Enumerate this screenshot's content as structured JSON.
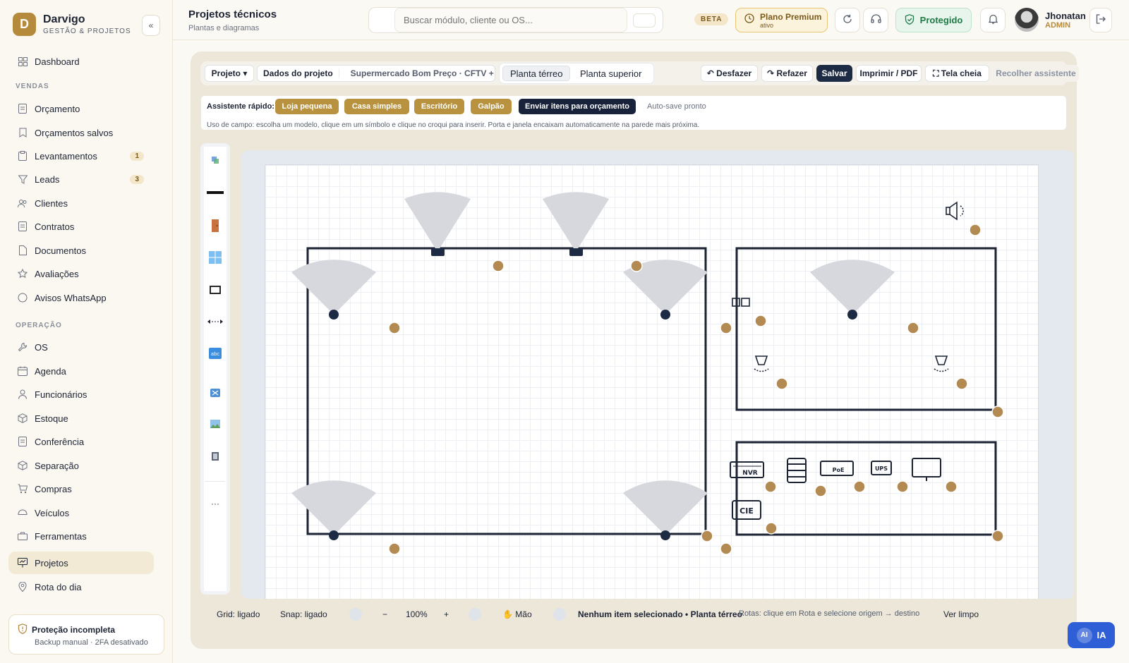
{
  "brand": {
    "initial": "D",
    "name": "Darvigo",
    "subtitle": "GESTÃO & PROJETOS",
    "collapse": "«"
  },
  "sidebar": {
    "items": [
      {
        "label": "Dashboard",
        "icon": "grid-icon"
      },
      {
        "section": "VENDAS"
      },
      {
        "label": "Orçamento",
        "icon": "document-icon"
      },
      {
        "label": "Orçamentos salvos",
        "icon": "bookmark-icon"
      },
      {
        "label": "Levantamentos",
        "icon": "clipboard-icon",
        "badge": "1"
      },
      {
        "label": "Leads",
        "icon": "filter-icon",
        "badge": "3"
      },
      {
        "label": "Clientes",
        "icon": "users-icon"
      },
      {
        "label": "Contratos",
        "icon": "document-icon"
      },
      {
        "label": "Documentos",
        "icon": "file-icon"
      },
      {
        "label": "Avaliações",
        "icon": "star-icon"
      },
      {
        "label": "Avisos WhatsApp",
        "icon": "chat-icon"
      },
      {
        "section": "OPERAÇÃO"
      },
      {
        "label": "OS",
        "icon": "wrench-icon"
      },
      {
        "label": "Agenda",
        "icon": "calendar-icon"
      },
      {
        "label": "Funcionários",
        "icon": "user-icon"
      },
      {
        "label": "Estoque",
        "icon": "box-icon"
      },
      {
        "label": "Conferência",
        "icon": "checklist-icon"
      },
      {
        "label": "Separação",
        "icon": "package-icon"
      },
      {
        "label": "Compras",
        "icon": "cart-icon"
      },
      {
        "label": "Veículos",
        "icon": "truck-icon"
      },
      {
        "label": "Ferramentas",
        "icon": "toolbox-icon"
      },
      {
        "label": "Projetos",
        "icon": "presentation-icon",
        "active": true
      },
      {
        "label": "Rota do dia",
        "icon": "pin-icon"
      }
    ],
    "protection": {
      "title": "Proteção incompleta",
      "subtitle": "Backup manual · 2FA desativado"
    }
  },
  "header": {
    "title": "Projetos técnicos",
    "subtitle": "Plantas e diagramas",
    "search_placeholder": "Buscar módulo, cliente ou OS...",
    "beta": "BETA",
    "plan_title": "Plano Premium",
    "plan_status": "ativo",
    "protected": "Protegido",
    "user_name": "Jhonatan",
    "user_role": "ADMIN"
  },
  "toolbar": {
    "project_menu": "Projeto ▾",
    "project_data": "Dados do projeto",
    "project_name": "Supermercado Bom Preço · CFTV + Alarme",
    "tabs": [
      "Planta térreo",
      "Planta superior"
    ],
    "undo": "↶ Desfazer",
    "redo": "↷ Refazer",
    "save": "Salvar",
    "print": "Imprimir / PDF",
    "fullscreen": "⛶ Tela cheia",
    "collapse_assistant": "Recolher assistente"
  },
  "assistant": {
    "label": "Assistente rápido:",
    "presets": [
      "Loja pequena",
      "Casa simples",
      "Escritório",
      "Galpão"
    ],
    "send": "Enviar itens para orçamento",
    "autosave": "Auto-save pronto",
    "hint": "Uso de campo: escolha um modelo, clique em um símbolo e clique no croqui para inserir. Porta e janela encaixam automaticamente na parede mais próxima."
  },
  "canvas_labels": {
    "nvr": "NVR",
    "poe": "PoE",
    "ups": "UPS",
    "cie": "CIE"
  },
  "colors": {
    "accent": "#b68a3c",
    "dark": "#1c2a44",
    "handle": "#b38b52",
    "wall": "#1c2333",
    "fov": "#d6d8dd"
  },
  "statusbar": {
    "grid": "Grid: ligado",
    "snap": "Snap: ligado",
    "zoom_out": "−",
    "zoom": "100%",
    "zoom_in": "+",
    "hand": "✋ Mão",
    "selection": "Nenhum item selecionado • Planta térreo",
    "routes": "Rotas: clique em Rota e selecione origem → destino",
    "clean_view": "Ver limpo"
  },
  "ai": {
    "badge": "AI",
    "label": "IA"
  }
}
